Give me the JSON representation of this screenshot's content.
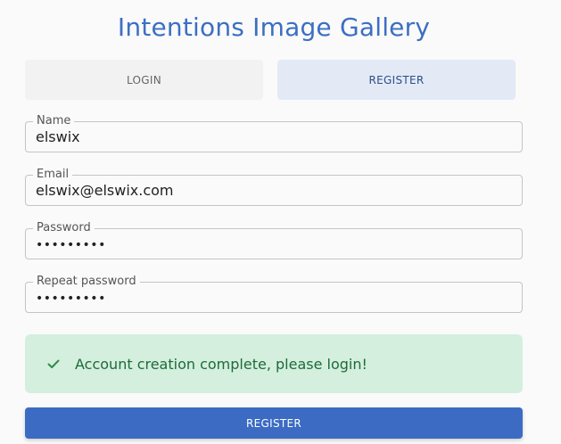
{
  "app": {
    "title": "Intentions Image Gallery"
  },
  "tabs": {
    "login_label": "LOGIN",
    "register_label": "REGISTER",
    "active": "register"
  },
  "form": {
    "name": {
      "label": "Name",
      "value": "elswix"
    },
    "email": {
      "label": "Email",
      "value": "elswix@elswix.com"
    },
    "password": {
      "label": "Password",
      "value": "•••••••••"
    },
    "repeat_password": {
      "label": "Repeat password",
      "value": "•••••••••"
    }
  },
  "alert": {
    "icon": "check-icon",
    "message": "Account creation complete, please login!",
    "color": "#1e6b39",
    "background": "#d4efde"
  },
  "submit": {
    "label": "REGISTER"
  },
  "colors": {
    "accent": "#3c6bc3",
    "title": "#3c6fc2"
  }
}
